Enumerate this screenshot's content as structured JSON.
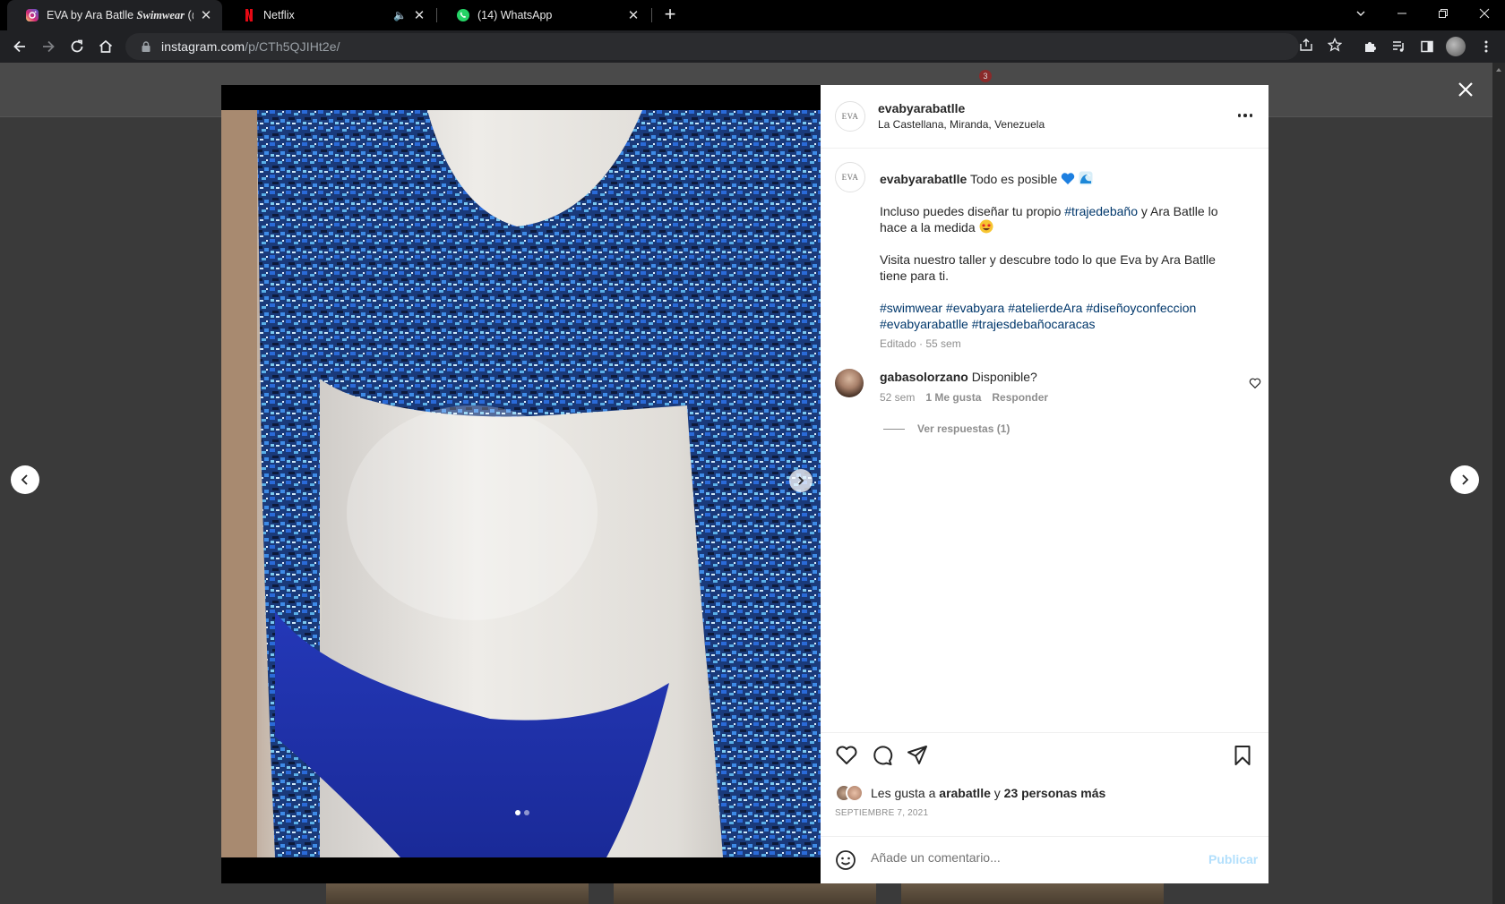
{
  "browser": {
    "tabs": [
      {
        "title": "EVA by Ara Batlle ",
        "title_styled": "Swimwear",
        "title_rest": " (@",
        "favicon": "instagram-icon",
        "active": true
      },
      {
        "title": "Netflix",
        "favicon": "netflix-icon",
        "active": false,
        "muted": true
      },
      {
        "title": "(14) WhatsApp",
        "favicon": "whatsapp-icon",
        "active": false
      }
    ],
    "url_host": "instagram.com",
    "url_path": "/p/CTh5QJIHt2e/",
    "header_badge": "3"
  },
  "post": {
    "username": "evabyarabatlle",
    "location": "La Castellana, Miranda, Venezuela",
    "avatar_text": "EVA",
    "caption": {
      "username": "evabyarabatlle",
      "first_line": "Todo es posible",
      "p1_before": "Incluso puedes diseñar tu propio ",
      "p1_tag": "#trajedebaño",
      "p1_after": " y Ara Batlle lo hace a la medida",
      "p2": "Visita nuestro taller y descubre todo lo que Eva by Ara Batlle tiene para ti.",
      "hashtags": [
        "#swimwear",
        "#evabyara",
        "#atelierdeAra",
        "#diseñoyconfeccion",
        "#evabyarabatlle",
        "#trajesdebañocaracas"
      ],
      "meta": "Editado · 55 sem"
    },
    "comment": {
      "username": "gabasolorzano",
      "text": "Disponible?",
      "time": "52 sem",
      "likes": "1 Me gusta",
      "reply": "Responder",
      "view_replies": "Ver respuestas (1)"
    },
    "likes": {
      "prefix": "Les gusta a ",
      "user": "arabatlle",
      "middle": " y ",
      "others": "23 personas más"
    },
    "date": "SEPTIEMBRE 7, 2021",
    "add_comment_placeholder": "Añade un comentario...",
    "publish_label": "Publicar",
    "carousel": {
      "count": 2,
      "current": 1
    }
  },
  "colors": {
    "link": "#00376b",
    "muted": "#8e8e8e",
    "publish_disabled": "#b2dffc"
  }
}
